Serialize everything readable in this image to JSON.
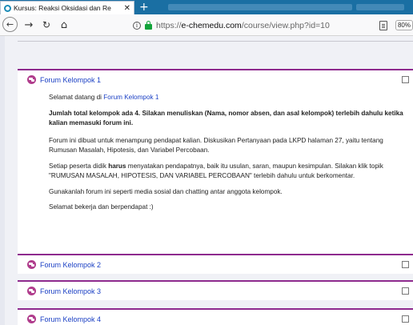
{
  "browser": {
    "tab_title": "Kursus: Reaksi Oksidasi dan Re",
    "tab_close": "✕",
    "new_tab": "+",
    "url_prefix": "https://",
    "url_domain": "e-chemedu.com",
    "url_path": "/course/view.php?id=10",
    "zoom": "80%",
    "icons": {
      "back": "back-arrow-icon",
      "forward": "forward-arrow-icon",
      "reload": "reload-icon",
      "home": "home-icon",
      "info": "info-icon",
      "lock": "lock-icon",
      "reader": "reader-view-icon"
    }
  },
  "forums": [
    {
      "title": "Forum Kelompok 1",
      "welcome_prefix": "Selamat datang di ",
      "welcome_link": "Forum Kelompok 1",
      "bold_note": "Jumlah total kelompok ada 4. Silakan menuliskan (Nama, nomor absen, dan asal kelompok) terlebih dahulu ketika kalian memasuki forum ini.",
      "para1": "Forum ini dibuat untuk menampung pendapat kalian. Diskusikan Pertanyaan pada LKPD halaman 27, yaitu tentang Rumusan Masalah, Hipotesis, dan Variabel Percobaan.",
      "para2_a": "Setiap peserta didik ",
      "para2_bold": "harus",
      "para2_b": " menyatakan pendapatnya, baik itu usulan, saran, maupun kesimpulan. Silakan klik topik \"RUMUSAN MASALAH, HIPOTESIS, DAN VARIABEL PERCOBAAN\" terlebih dahulu untuk berkomentar.",
      "para3": "Gunakanlah forum ini seperti media sosial dan chatting antar anggota kelompok.",
      "para4": "Selamat bekerja dan berpendapat :)"
    },
    {
      "title": "Forum Kelompok 2"
    },
    {
      "title": "Forum Kelompok 3"
    },
    {
      "title": "Forum Kelompok 4"
    }
  ],
  "colors": {
    "section_border": "#8e2a8e",
    "link": "#1a3fc4",
    "forum_icon": "#b03c8c",
    "tabbar": "#1a6fa3"
  }
}
